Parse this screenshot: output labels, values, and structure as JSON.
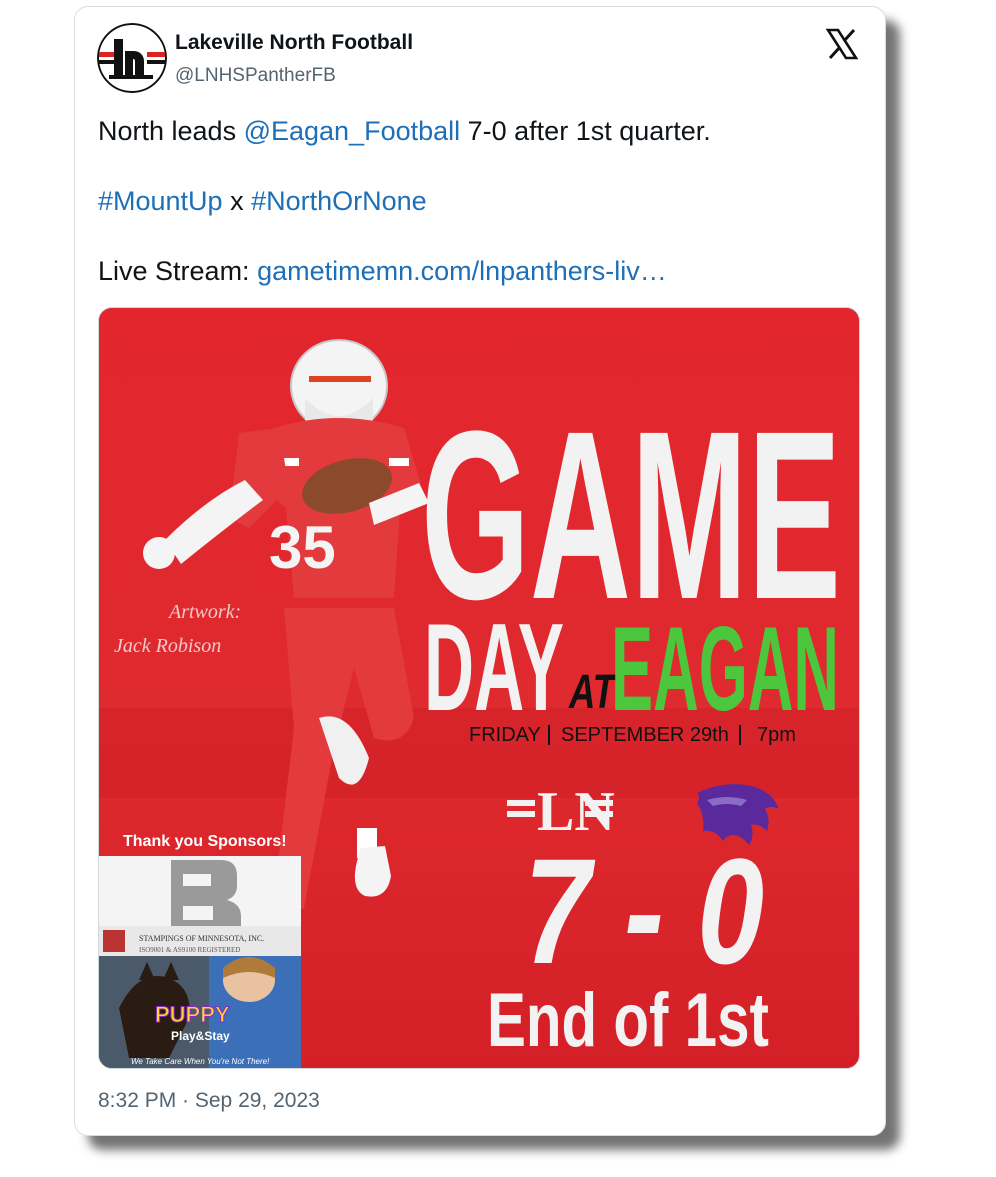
{
  "tweet": {
    "display_name": "Lakeville North Football",
    "handle": "@LNHSPantherFB",
    "text_line1_pre": "North leads ",
    "mention": "@Eagan_Football",
    "text_line1_post": " 7-0 after 1st quarter.",
    "hashtag1": "#MountUp",
    "hashtag_sep": " x ",
    "hashtag2": "#NorthOrNone",
    "stream_label": "Live Stream: ",
    "stream_link": "gametimemn.com/lnpanthers-liv…",
    "timestamp": "8:32 PM · Sep 29, 2023"
  },
  "graphic": {
    "headline_1": "GAME",
    "headline_2a": "DAY",
    "headline_2b": "AT",
    "headline_2c": "EAGAN",
    "date_day": "FRIDAY",
    "date_date": "SEPTEMBER 29th",
    "date_time": "7pm",
    "home_logo": "LN",
    "score": "7 - 0",
    "period": "End of 1st",
    "artwork_label": "Artwork:",
    "artist": "Jack Robison",
    "jersey_number": "35",
    "sponsors_label": "Thank you Sponsors!",
    "sponsor1_name": "STAMPINGS OF MINNESOTA, INC.",
    "sponsor1_sub": "ISO9001 & AS9100 REGISTERED",
    "sponsor2_name": "PUPPY",
    "sponsor2_sub": "Play&Stay",
    "sponsor2_tagline": "We Take Care When You're Not There!"
  },
  "colors": {
    "background_red": "#e0252d",
    "headline_white": "#f2f2f2",
    "eagan_green": "#4cc63c",
    "eagan_purple": "#5a2a9c",
    "link_blue": "#1d6fb8"
  },
  "icons": [
    "x-logo-icon",
    "ln-logo-icon",
    "wildcat-logo-icon"
  ]
}
